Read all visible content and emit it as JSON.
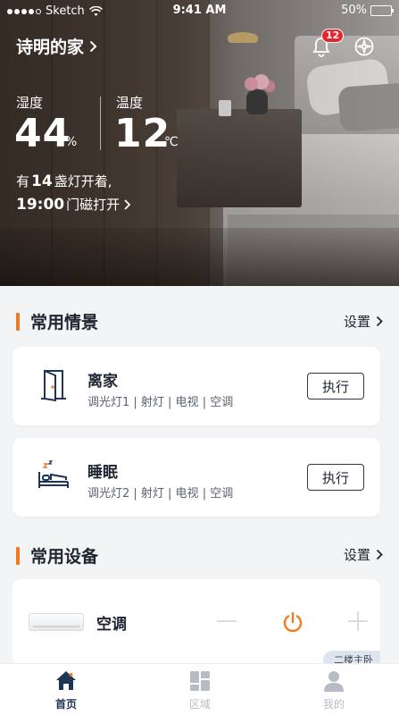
{
  "status_bar": {
    "carrier": "Sketch",
    "time": "9:41 AM",
    "battery": "50%",
    "battery_level": 0.5
  },
  "header": {
    "home_name": "诗明的家",
    "notification_count": "12"
  },
  "climate": {
    "humidity_label": "湿度",
    "humidity_value": "44",
    "humidity_unit": "%",
    "temperature_label": "温度",
    "temperature_value": "12",
    "temperature_unit": "℃"
  },
  "summary": {
    "lights_prefix": "有",
    "lights_count": "14",
    "lights_suffix": "盏灯开着,",
    "door_time": "19:00",
    "door_text": "门磁打开"
  },
  "scenes_section": {
    "title": "常用情景",
    "settings_label": "设置",
    "items": [
      {
        "name": "离家",
        "devices": "调光灯1 | 射灯 | 电视 | 空调",
        "action": "执行",
        "icon": "door-open-icon"
      },
      {
        "name": "睡眠",
        "devices": "调光灯2 | 射灯 | 电视 | 空调",
        "action": "执行",
        "icon": "bed-sleep-icon"
      }
    ]
  },
  "devices_section": {
    "title": "常用设备",
    "settings_label": "设置",
    "items": [
      {
        "name": "空调",
        "room": "二楼主卧",
        "icon": "air-conditioner-icon"
      }
    ]
  },
  "tab_bar": {
    "tabs": [
      {
        "label": "首页",
        "icon": "home-icon",
        "active": true
      },
      {
        "label": "区域",
        "icon": "grid-icon",
        "active": false
      },
      {
        "label": "我的",
        "icon": "profile-icon",
        "active": false
      }
    ]
  },
  "colors": {
    "accent": "#ef7b22",
    "badge": "#e8242d",
    "tab_active": "#1f3554",
    "tab_inactive": "#b7bcc4"
  }
}
